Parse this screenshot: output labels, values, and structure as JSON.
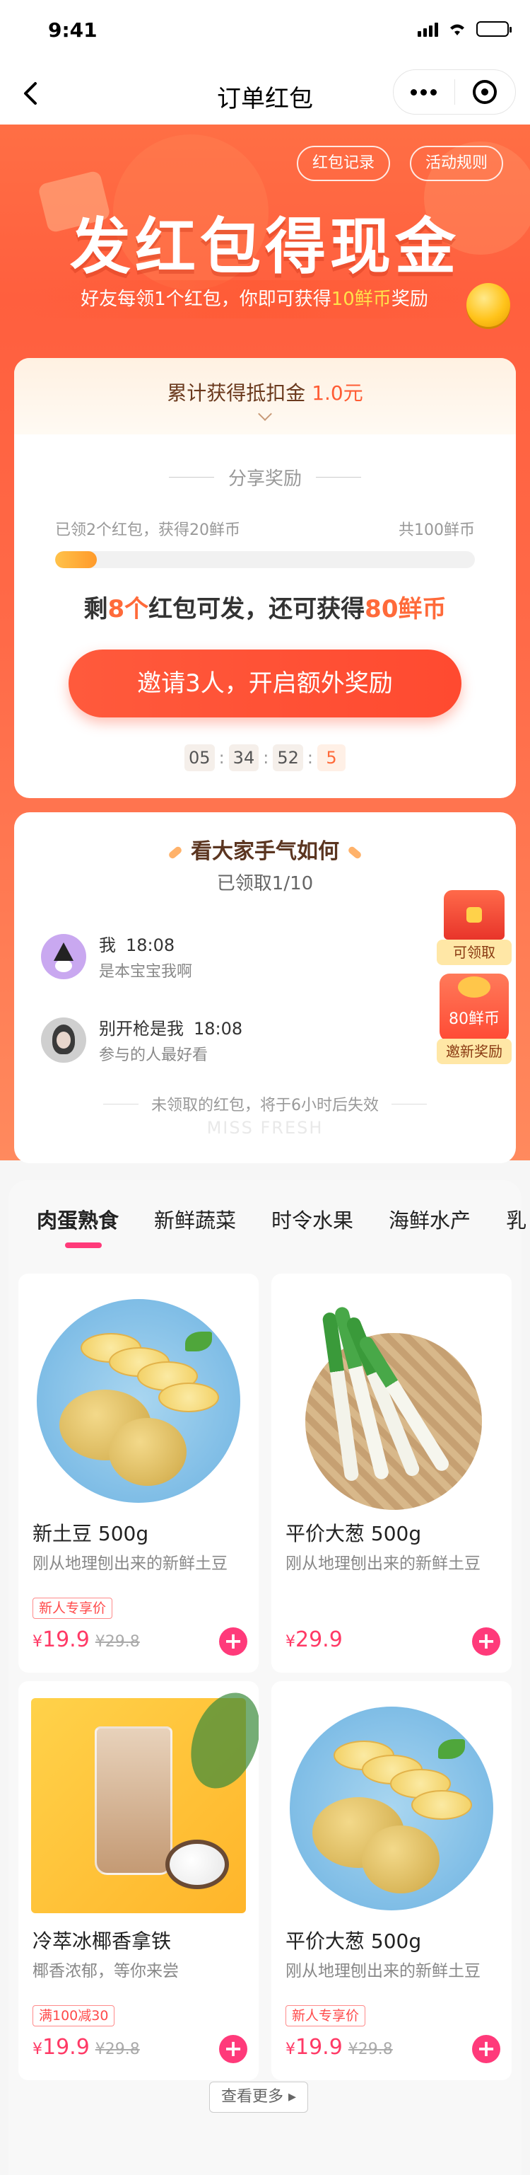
{
  "status_bar": {
    "time": "9:41"
  },
  "nav": {
    "title": "订单红包"
  },
  "hero": {
    "record_chip": "红包记录",
    "rules_chip": "活动规则",
    "title": "发红包得现金",
    "subtitle_pre": "好友每领1个红包，你即可获得",
    "subtitle_highlight": "10鲜币",
    "subtitle_post": "奖励"
  },
  "reward": {
    "total_label": "累计获得抵扣金",
    "total_value": "1.0元",
    "share_heading": "分享奖励",
    "progress_left": "已领2个红包，获得20鲜币",
    "progress_right": "共100鲜币",
    "progress_fraction": 0.1,
    "remain_pre": "剩",
    "remain_count": "8个",
    "remain_mid": "红包可发，还可获得",
    "remain_value": "80鲜币",
    "invite_button": "邀请3人，开启额外奖励",
    "countdown": {
      "h": "05",
      "m": "34",
      "s": "52",
      "ms": "5"
    }
  },
  "friends": {
    "title": "看大家手气如何",
    "count": "已领取1/10",
    "rows": [
      {
        "name": "我",
        "time": "18:08",
        "message": "是本宝宝我啊"
      },
      {
        "name": "别开枪是我",
        "time": "18:08",
        "message": "参与的人最好看"
      }
    ],
    "chest_label": "可领取",
    "bag_amount": "80鲜币",
    "bag_label": "邀新奖励",
    "expire_note": "未领取的红包，将于6小时后失效",
    "brand": "MISS FRESH"
  },
  "products": {
    "tabs": [
      "肉蛋熟食",
      "新鲜蔬菜",
      "时令水果",
      "海鲜水产",
      "乳"
    ],
    "accent": "#ff3a7a",
    "items": [
      {
        "name": "新土豆 500g",
        "desc": "刚从地理刨出来的新鲜土豆",
        "badge": "新人专享价",
        "currency": "¥",
        "price": "19.9",
        "old_price": "¥29.8"
      },
      {
        "name": "平价大葱 500g",
        "desc": "刚从地理刨出来的新鲜土豆",
        "badge": "",
        "currency": "¥",
        "price": "29.9",
        "old_price": ""
      },
      {
        "name": "冷萃冰椰香拿铁",
        "desc": "椰香浓郁，等你来尝",
        "badge": "满100减30",
        "currency": "¥",
        "price": "19.9",
        "old_price": "¥29.8"
      },
      {
        "name": "平价大葱 500g",
        "desc": "刚从地理刨出来的新鲜土豆",
        "badge": "新人专享价",
        "currency": "¥",
        "price": "19.9",
        "old_price": "¥29.8"
      }
    ],
    "add_symbol": "+",
    "more_button": "查看更多 ▸"
  }
}
